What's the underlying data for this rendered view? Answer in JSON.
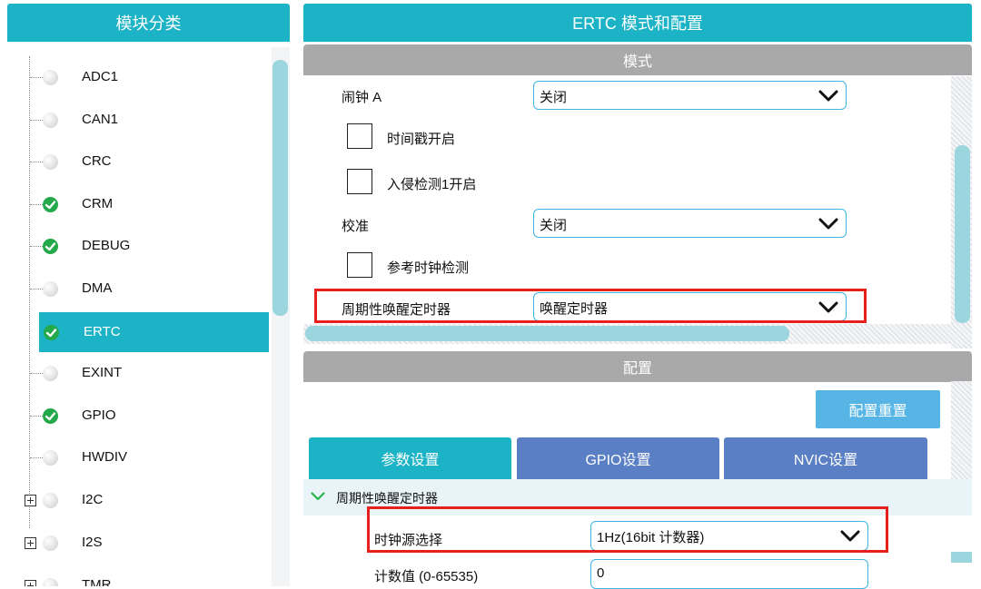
{
  "left_panel": {
    "title": "模块分类",
    "modules": [
      {
        "label": "ADC1",
        "checked": false,
        "selected": false,
        "expandable": false
      },
      {
        "label": "CAN1",
        "checked": false,
        "selected": false,
        "expandable": false
      },
      {
        "label": "CRC",
        "checked": false,
        "selected": false,
        "expandable": false
      },
      {
        "label": "CRM",
        "checked": true,
        "selected": false,
        "expandable": false
      },
      {
        "label": "DEBUG",
        "checked": true,
        "selected": false,
        "expandable": false
      },
      {
        "label": "DMA",
        "checked": false,
        "selected": false,
        "expandable": false
      },
      {
        "label": "ERTC",
        "checked": true,
        "selected": true,
        "expandable": false
      },
      {
        "label": "EXINT",
        "checked": false,
        "selected": false,
        "expandable": false
      },
      {
        "label": "GPIO",
        "checked": true,
        "selected": false,
        "expandable": false
      },
      {
        "label": "HWDIV",
        "checked": false,
        "selected": false,
        "expandable": false
      },
      {
        "label": "I2C",
        "checked": false,
        "selected": false,
        "expandable": true
      },
      {
        "label": "I2S",
        "checked": false,
        "selected": false,
        "expandable": true
      },
      {
        "label": "TMR",
        "checked": false,
        "selected": false,
        "expandable": true
      }
    ]
  },
  "right_panel": {
    "title": "ERTC 模式和配置",
    "mode_section": {
      "title": "模式",
      "alarm_a": {
        "label": "闹钟 A",
        "value": "关闭"
      },
      "timestamp": {
        "label": "时间戳开启"
      },
      "tamper1": {
        "label": "入侵检测1开启"
      },
      "calibration": {
        "label": "校准",
        "value": "关闭"
      },
      "ref_clock_detect": {
        "label": "参考时钟检测"
      },
      "periodic_wakeup": {
        "label": "周期性唤醒定时器",
        "value": "唤醒定时器"
      }
    },
    "config_section": {
      "title": "配置",
      "reset_button": "配置重置",
      "tabs": [
        "参数设置",
        "GPIO设置",
        "NVIC设置"
      ],
      "group_title": "周期性唤醒定时器",
      "clock_source": {
        "label": "时钟源选择",
        "value": "1Hz(16bit 计数器)"
      },
      "counter": {
        "label": "计数值 (0-65535)",
        "value": "0"
      }
    }
  },
  "colors": {
    "header": "#1db3c6",
    "tab_inactive": "#5a7fc4",
    "section_bar": "#a9a9a9",
    "highlight": "#e8201c",
    "check_green": "#23a84a"
  }
}
